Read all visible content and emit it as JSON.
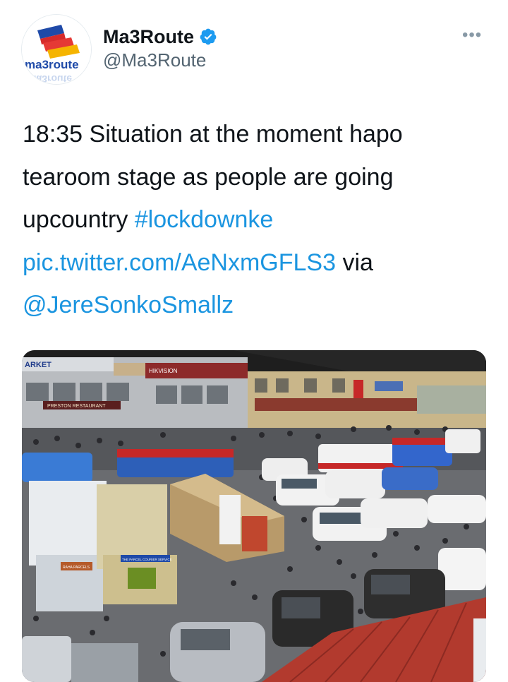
{
  "account": {
    "display_name": "Ma3Route",
    "handle": "@Ma3Route",
    "verified": true,
    "avatar_logo_text": "ma3route",
    "verified_icon": "verified-badge-icon",
    "menu_icon": "more-options-icon",
    "menu_glyph": "•••"
  },
  "tweet": {
    "time": "18:35",
    "text_body": " Situation at the moment hapo tearoom stage as people are going upcountry ",
    "hashtag": "#lockdownke",
    "pic_link": "pic.twitter.com/AeNxmGFLS3",
    "via_text": " via ",
    "mention": "@JereSonkoSmallz"
  },
  "photo": {
    "signs": {
      "market": "ARKET",
      "hikvision": "HIKVISION",
      "restaurant": "PRESTON RESTAURANT",
      "parcels": "RAHA PARCELS",
      "courier": "THE PARCEL COURIER SERVICE"
    }
  },
  "colors": {
    "link": "#1b95e0",
    "verified": "#1d9bf0",
    "text": "#0f1419",
    "secondary": "#536471"
  }
}
